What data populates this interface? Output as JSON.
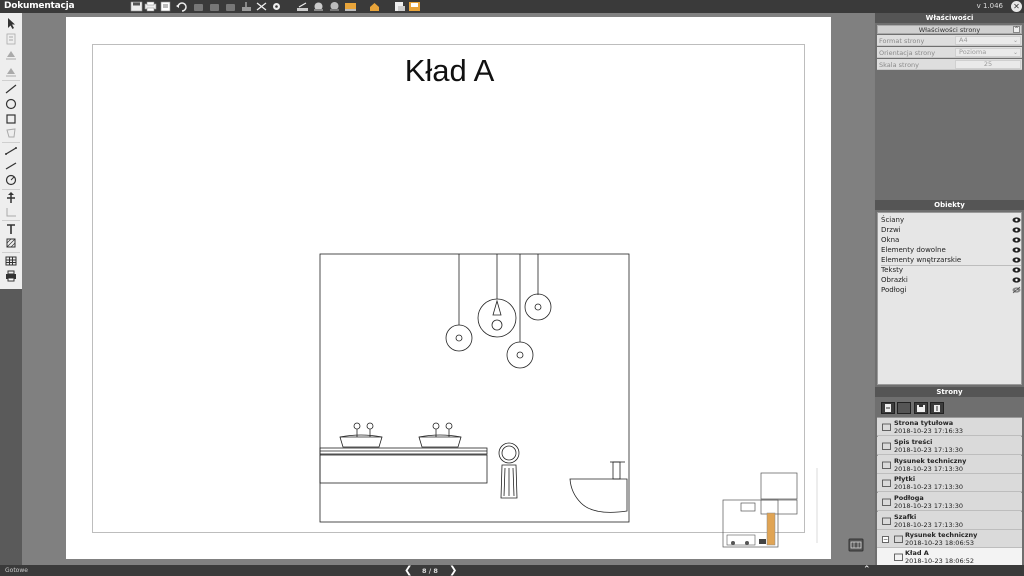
{
  "app": {
    "title": "Dokumentacja",
    "version": "v 1.046",
    "close_glyph": "✕"
  },
  "toolbar": {
    "top_buttons": [
      "save-icon",
      "print-icon",
      "export-icon",
      "undo-icon",
      "disabled-icon",
      "disabled-icon",
      "disabled-icon",
      "crane-icon",
      "cut-icon",
      "gear-icon",
      "draw-tool-icon",
      "bucket-icon",
      "scale-icon",
      "paint-icon",
      "home-tool-icon",
      "export-doc-icon",
      "open-doc-icon"
    ],
    "left_tools": [
      "arrow-pointer-icon",
      "text-box-icon",
      "align-top-icon",
      "align-bottom-icon",
      "line-icon",
      "circle-icon",
      "rectangle-icon",
      "polygon-icon",
      "dimension-icon",
      "arc-dimension-icon",
      "angle-icon",
      "anchor-icon",
      "grid-guide-icon",
      "text-icon",
      "hatch-icon",
      "table-icon",
      "print-preview-icon"
    ]
  },
  "document": {
    "page_title": "Kład A"
  },
  "properties": {
    "header": "Właściwości",
    "section": "Właściwości strony",
    "rows": [
      {
        "label": "Format strony",
        "value": "A4"
      },
      {
        "label": "Orientacja strony",
        "value": "Pozioma"
      },
      {
        "label": "Skala strony",
        "value": "25"
      }
    ]
  },
  "objects": {
    "header": "Obiekty",
    "items": [
      {
        "label": "Ściany",
        "visible": true
      },
      {
        "label": "Drzwi",
        "visible": true
      },
      {
        "label": "Okna",
        "visible": true
      },
      {
        "label": "Elementy dowolne",
        "visible": true
      },
      {
        "label": "Elementy wnętrzarskie",
        "visible": true
      },
      {
        "label": "Teksty",
        "visible": true
      },
      {
        "label": "Obrazki",
        "visible": true
      },
      {
        "label": "Podłogi",
        "visible": false
      }
    ]
  },
  "pages": {
    "header": "Strony",
    "items": [
      {
        "title": "Strona tytułowa",
        "date": "2018-10-23 17:16:33"
      },
      {
        "title": "Spis treści",
        "date": "2018-10-23 17:13:30"
      },
      {
        "title": "Rysunek techniczny",
        "date": "2018-10-23 17:13:30"
      },
      {
        "title": "Płytki",
        "date": "2018-10-23 17:13:30"
      },
      {
        "title": "Podłoga",
        "date": "2018-10-23 17:13:30"
      },
      {
        "title": "Szafki",
        "date": "2018-10-23 17:13:30"
      },
      {
        "title": "Rysunek techniczny",
        "date": "2018-10-23 18:06:53"
      },
      {
        "title": "Kład A",
        "date": "2018-10-23 18:06:52"
      }
    ],
    "tree_toggle": "−"
  },
  "status": {
    "text": "Gotowe",
    "page_counter": "8 / 8",
    "prev_glyph": "❮",
    "next_glyph": "❯",
    "expand_glyph": "⌃"
  }
}
